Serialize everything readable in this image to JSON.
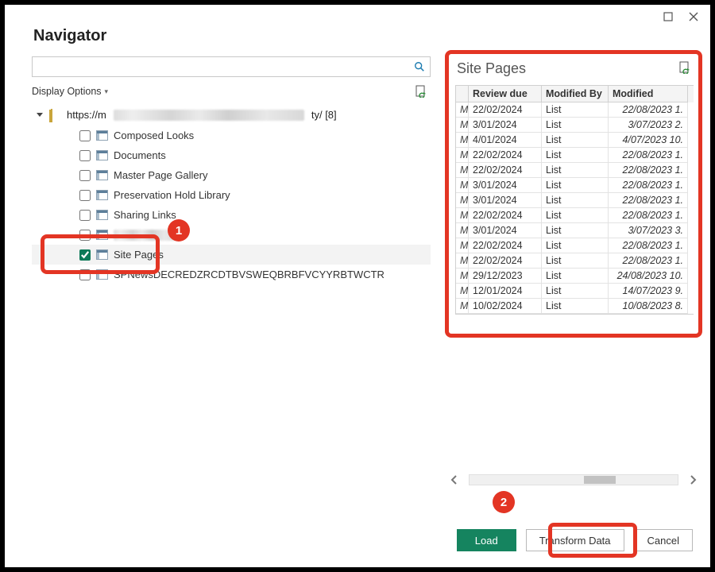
{
  "title": "Navigator",
  "window": {
    "maximize_label": "Maximize",
    "close_label": "Close"
  },
  "search": {
    "placeholder": ""
  },
  "display_options_label": "Display Options",
  "root": {
    "prefix": "https://m",
    "suffix": "ty/ [8]"
  },
  "tree": [
    {
      "label": "Composed Looks",
      "checked": false
    },
    {
      "label": "Documents",
      "checked": false
    },
    {
      "label": "Master Page Gallery",
      "checked": false
    },
    {
      "label": "Preservation Hold Library",
      "checked": false
    },
    {
      "label": "Sharing Links",
      "checked": false
    },
    {
      "label": "",
      "checked": false
    },
    {
      "label": "Site Pages",
      "checked": true,
      "selected": true
    },
    {
      "label": "SPNewsDECREDZRCDTBVSWEQBRBFVCYYRBTWCTR",
      "checked": false
    }
  ],
  "annotations": {
    "badge1": "1",
    "badge2": "2"
  },
  "preview": {
    "title": "Site Pages",
    "columns": [
      "",
      "Review due",
      "Modified By",
      "Modified"
    ],
    "rows": [
      {
        "m": "M",
        "review_due": "22/02/2024",
        "modified_by": "List",
        "modified": "22/08/2023 1."
      },
      {
        "m": "M",
        "review_due": "3/01/2024",
        "modified_by": "List",
        "modified": "3/07/2023 2."
      },
      {
        "m": "M",
        "review_due": "4/01/2024",
        "modified_by": "List",
        "modified": "4/07/2023 10."
      },
      {
        "m": "M",
        "review_due": "22/02/2024",
        "modified_by": "List",
        "modified": "22/08/2023 1."
      },
      {
        "m": "M",
        "review_due": "22/02/2024",
        "modified_by": "List",
        "modified": "22/08/2023 1."
      },
      {
        "m": "M",
        "review_due": "3/01/2024",
        "modified_by": "List",
        "modified": "22/08/2023 1."
      },
      {
        "m": "M",
        "review_due": "3/01/2024",
        "modified_by": "List",
        "modified": "22/08/2023 1."
      },
      {
        "m": "M",
        "review_due": "22/02/2024",
        "modified_by": "List",
        "modified": "22/08/2023 1."
      },
      {
        "m": "M",
        "review_due": "3/01/2024",
        "modified_by": "List",
        "modified": "3/07/2023 3."
      },
      {
        "m": "M",
        "review_due": "22/02/2024",
        "modified_by": "List",
        "modified": "22/08/2023 1."
      },
      {
        "m": "M",
        "review_due": "22/02/2024",
        "modified_by": "List",
        "modified": "22/08/2023 1."
      },
      {
        "m": "M",
        "review_due": "29/12/2023",
        "modified_by": "List",
        "modified": "24/08/2023 10."
      },
      {
        "m": "M",
        "review_due": "12/01/2024",
        "modified_by": "List",
        "modified": "14/07/2023 9."
      },
      {
        "m": "M",
        "review_due": "10/02/2024",
        "modified_by": "List",
        "modified": "10/08/2023 8."
      }
    ]
  },
  "buttons": {
    "load": "Load",
    "transform": "Transform Data",
    "cancel": "Cancel"
  }
}
